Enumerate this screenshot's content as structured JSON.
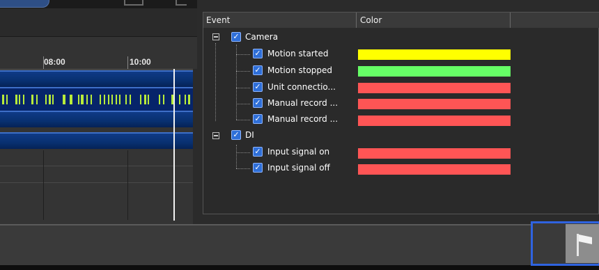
{
  "timeline": {
    "time_labels": [
      "08:00",
      "10:00"
    ]
  },
  "event_panel": {
    "columns": {
      "event": "Event",
      "color": "Color"
    },
    "groups": [
      {
        "label": "Camera",
        "checked": true,
        "expanded": true,
        "events": [
          {
            "label": "Motion started",
            "checked": true,
            "color": "#ffff00"
          },
          {
            "label": "Motion stopped",
            "checked": true,
            "color": "#66ff66"
          },
          {
            "label": "Unit connectio...",
            "checked": true,
            "color": "#ff5555"
          },
          {
            "label": "Manual record ...",
            "checked": true,
            "color": "#ff5555"
          },
          {
            "label": "Manual record ...",
            "checked": true,
            "color": "#ff5555"
          }
        ]
      },
      {
        "label": "DI",
        "checked": true,
        "expanded": true,
        "events": [
          {
            "label": "Input signal on",
            "checked": true,
            "color": "#ff5555"
          },
          {
            "label": "Input signal off",
            "checked": true,
            "color": "#ff5555"
          }
        ]
      }
    ]
  },
  "icons": {
    "expander": "collapse-icon",
    "checkbox": "checkmark-icon",
    "bookmark": "flag-icon"
  },
  "colors": {
    "accent_focus": "#2f63e0",
    "timeline_band": "#083070",
    "recording_mark": "#b8ec3a"
  }
}
